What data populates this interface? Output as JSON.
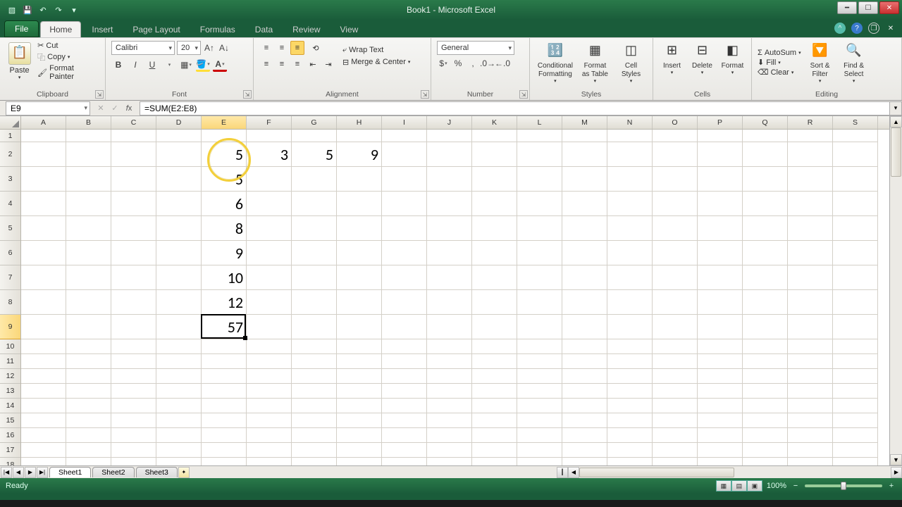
{
  "app": {
    "title": "Book1 - Microsoft Excel"
  },
  "tabs": {
    "file": "File",
    "items": [
      "Home",
      "Insert",
      "Page Layout",
      "Formulas",
      "Data",
      "Review",
      "View"
    ],
    "active": 0
  },
  "ribbon": {
    "clipboard": {
      "paste": "Paste",
      "cut": "Cut",
      "copy": "Copy",
      "format_painter": "Format Painter",
      "label": "Clipboard"
    },
    "font": {
      "name": "Calibri",
      "size": "20",
      "label": "Font"
    },
    "alignment": {
      "wrap": "Wrap Text",
      "merge": "Merge & Center",
      "label": "Alignment"
    },
    "number": {
      "format": "General",
      "label": "Number"
    },
    "styles": {
      "cond": "Conditional\nFormatting",
      "table": "Format\nas Table",
      "cell": "Cell\nStyles",
      "label": "Styles"
    },
    "cells": {
      "insert": "Insert",
      "delete": "Delete",
      "format": "Format",
      "label": "Cells"
    },
    "editing": {
      "autosum": "AutoSum",
      "fill": "Fill",
      "clear": "Clear",
      "sort": "Sort &\nFilter",
      "find": "Find &\nSelect",
      "label": "Editing"
    }
  },
  "namebox": "E9",
  "formula": "=SUM(E2:E8)",
  "columns": [
    "A",
    "B",
    "C",
    "D",
    "E",
    "F",
    "G",
    "H",
    "I",
    "J",
    "K",
    "L",
    "M",
    "N",
    "O",
    "P",
    "Q",
    "R",
    "S"
  ],
  "rows_shown": 18,
  "active_cell": {
    "col": 4,
    "row": 8
  },
  "chart_data": {
    "type": "table",
    "title": "Spreadsheet cell values",
    "columns": [
      "A",
      "B",
      "C",
      "D",
      "E",
      "F",
      "G",
      "H",
      "I",
      "J",
      "K",
      "L",
      "M",
      "N",
      "O",
      "P",
      "Q",
      "R",
      "S"
    ],
    "cells": {
      "E2": 5,
      "F2": 3,
      "G2": 5,
      "H2": 9,
      "E3": 5,
      "E4": 6,
      "E5": 8,
      "E6": 9,
      "E7": 10,
      "E8": 12,
      "E9": 57
    },
    "formula_E9": "=SUM(E2:E8)"
  },
  "sheets": [
    "Sheet1",
    "Sheet2",
    "Sheet3"
  ],
  "status": {
    "ready": "Ready",
    "zoom": "100%"
  }
}
